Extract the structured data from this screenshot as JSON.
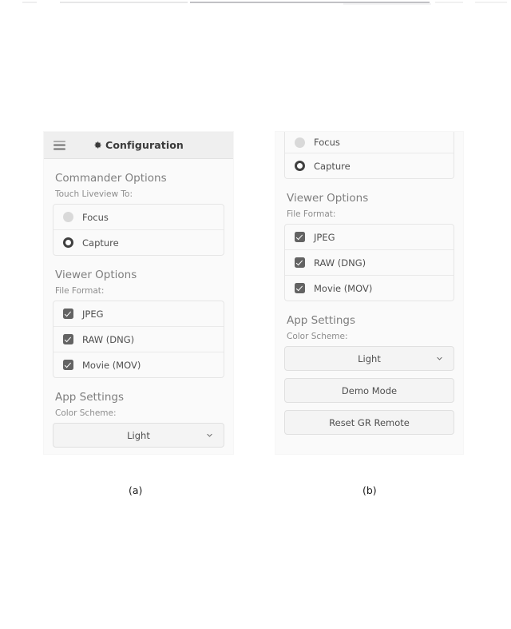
{
  "figure": {
    "caption_a": "(a)",
    "caption_b": "(b)"
  },
  "panel_a": {
    "header": {
      "menu_icon": "hamburger-icon",
      "gear_icon": "gear-icon",
      "title": "Configuration"
    },
    "commander_options": {
      "section_title": "Commander Options",
      "field_label": "Touch Liveview To:",
      "options": [
        {
          "label": "Focus",
          "selected": false
        },
        {
          "label": "Capture",
          "selected": true
        }
      ]
    },
    "viewer_options": {
      "section_title": "Viewer Options",
      "field_label": "File Format:",
      "options": [
        {
          "label": "JPEG",
          "checked": true
        },
        {
          "label": "RAW (DNG)",
          "checked": true
        },
        {
          "label": "Movie (MOV)",
          "checked": true
        }
      ]
    },
    "app_settings": {
      "section_title": "App Settings",
      "field_label": "Color Scheme:",
      "color_scheme_value": "Light",
      "chevron_icon": "chevron-down-icon"
    }
  },
  "panel_b": {
    "commander_options_partial": {
      "options": [
        {
          "label": "Focus",
          "selected": false
        },
        {
          "label": "Capture",
          "selected": true
        }
      ]
    },
    "viewer_options": {
      "section_title": "Viewer Options",
      "field_label": "File Format:",
      "options": [
        {
          "label": "JPEG",
          "checked": true
        },
        {
          "label": "RAW (DNG)",
          "checked": true
        },
        {
          "label": "Movie (MOV)",
          "checked": true
        }
      ]
    },
    "app_settings": {
      "section_title": "App Settings",
      "field_label": "Color Scheme:",
      "color_scheme_value": "Light",
      "chevron_icon": "chevron-down-icon",
      "demo_mode_label": "Demo Mode",
      "reset_label": "Reset GR Remote"
    }
  },
  "colors": {
    "panel_background": "#fafafa",
    "header_background": "#efefef",
    "heading_text": "#7e7e7e",
    "body_text": "#4f4f4f",
    "checkbox_fill": "#636363",
    "radio_off_fill": "#d9d9d9",
    "radio_on_ring": "#3f3f3f",
    "border": "#e6e6e6"
  }
}
